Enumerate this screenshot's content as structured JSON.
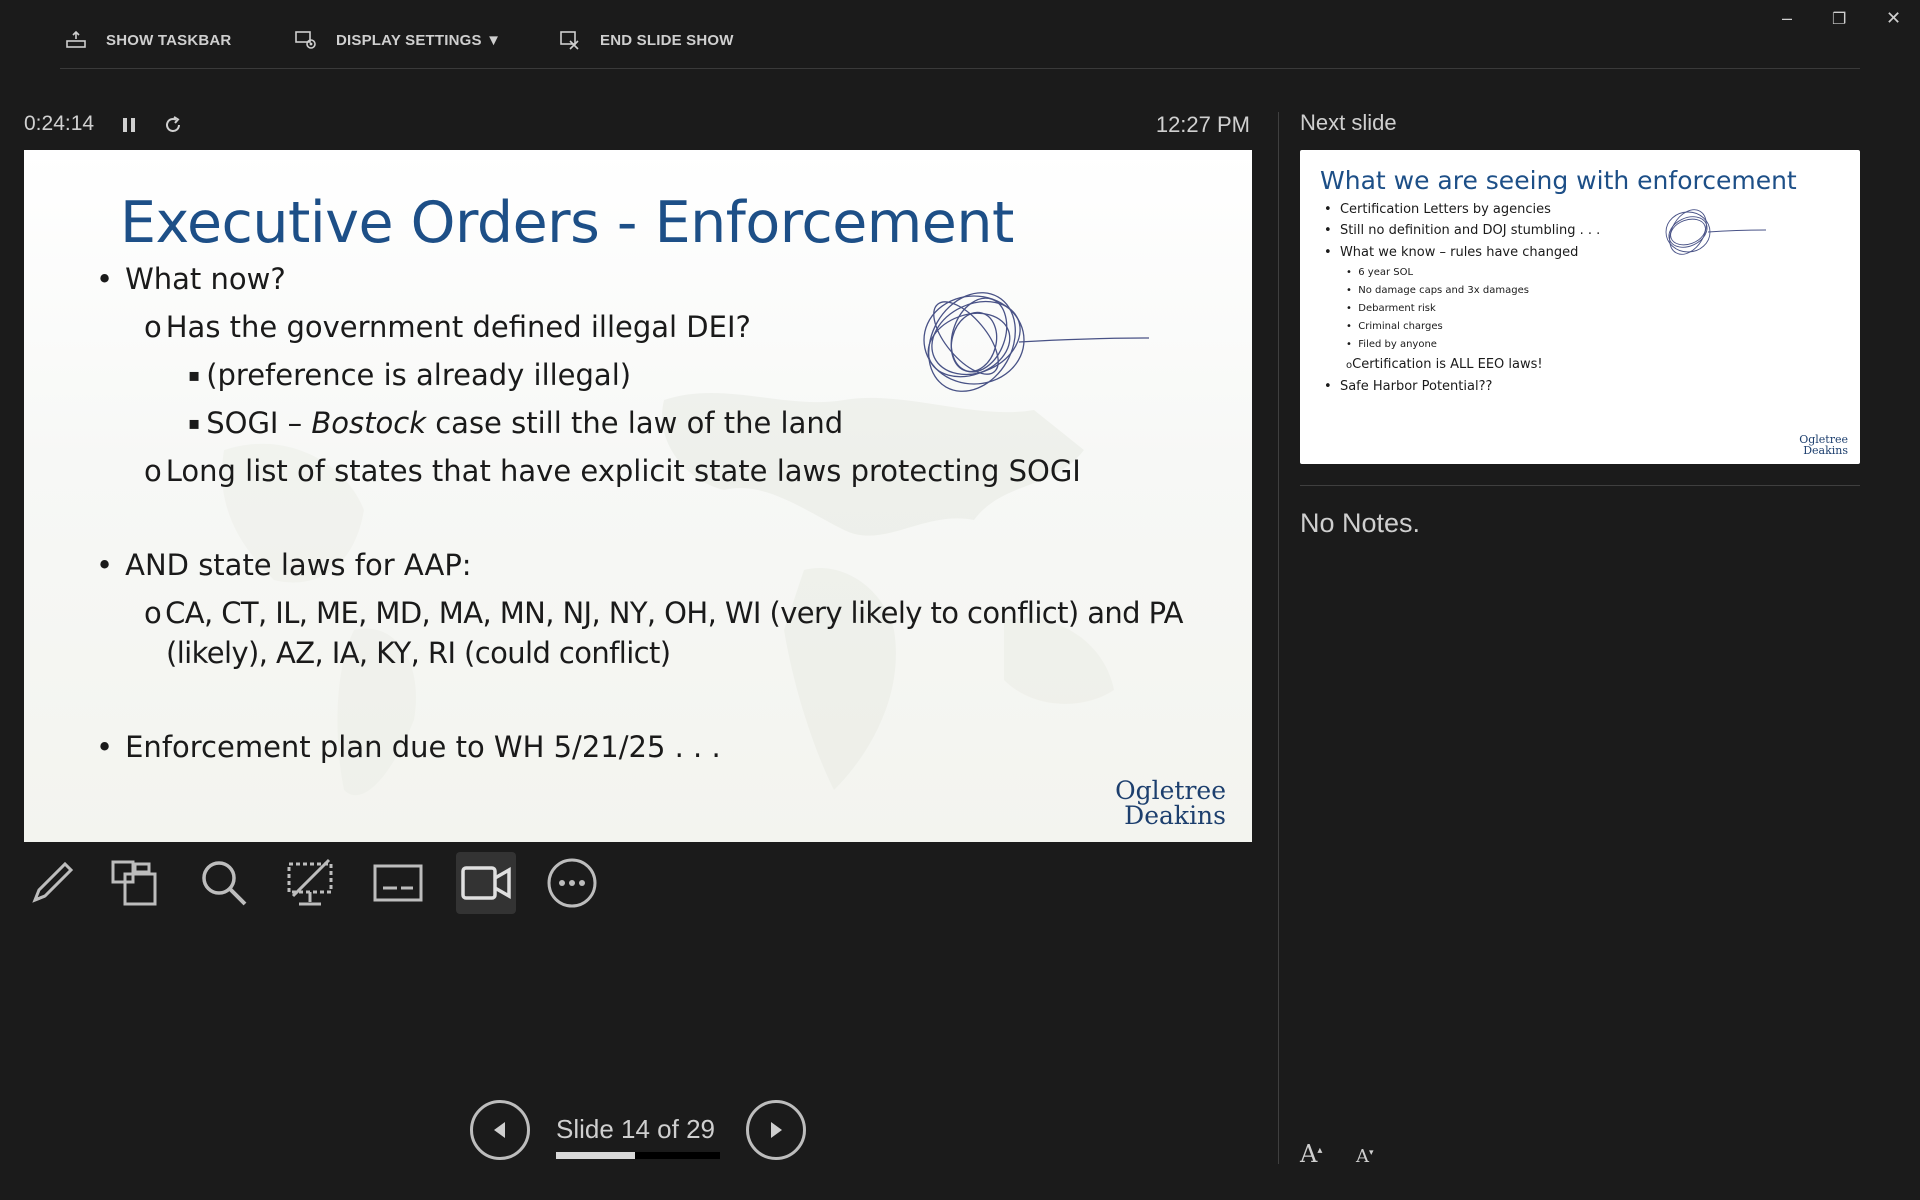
{
  "toolbar": {
    "show_taskbar": "SHOW TASKBAR",
    "display_settings": "DISPLAY SETTINGS ▼",
    "end_slide_show": "END SLIDE SHOW"
  },
  "window_controls": {
    "minimize": "–",
    "restore": "❐",
    "close": "✕"
  },
  "timer": {
    "elapsed": "0:24:14",
    "clock": "12:27 PM"
  },
  "current_slide": {
    "title": "Executive Orders - Enforcement",
    "b1": "What now?",
    "b1_1": "Has the government defined illegal DEI?",
    "b1_1_1": "(preference is already illegal)",
    "b1_1_2_pre": "SOGI – ",
    "b1_1_2_em": "Bostock",
    "b1_1_2_post": " case still the law of the land",
    "b1_2": "Long list of states that have explicit state laws protecting SOGI",
    "b2": "AND state laws for AAP:",
    "b2_1_line1": "CA, CT, IL, ME, MD, MA, MN, NJ, NY, OH, WI (very likely to conflict) and PA",
    "b2_1_line2": "(likely), AZ, IA, KY, RI (could conflict)",
    "b3": "Enforcement plan due to WH 5/21/25 . . .",
    "logo_line1": "Ogletree",
    "logo_line2": "Deakins"
  },
  "bullets": {
    "l1": "•",
    "l2": "o",
    "l3": "▪"
  },
  "tools": [
    "pen-icon",
    "see-all-slides-icon",
    "zoom-icon",
    "black-screen-icon",
    "subtitles-icon",
    "camera-icon",
    "more-options-icon"
  ],
  "navigation": {
    "slide_counter": "Slide 14 of 29",
    "progress": 0.48
  },
  "next_slide": {
    "label": "Next slide",
    "title": "What we are seeing with enforcement",
    "items": [
      "Certification Letters by agencies",
      "Still no definition and DOJ stumbling . . .",
      "What we know – rules have changed",
      "6 year SOL",
      "No damage caps and 3x damages",
      "Debarment risk",
      "Criminal charges",
      "Filed by anyone",
      "Certification is ALL EEO laws!",
      "Safe Harbor Potential??"
    ],
    "logo_line1": "Ogletree",
    "logo_line2": "Deakins"
  },
  "notes": {
    "text": "No Notes."
  },
  "font_controls": {
    "increase": "A",
    "decrease": "A"
  }
}
